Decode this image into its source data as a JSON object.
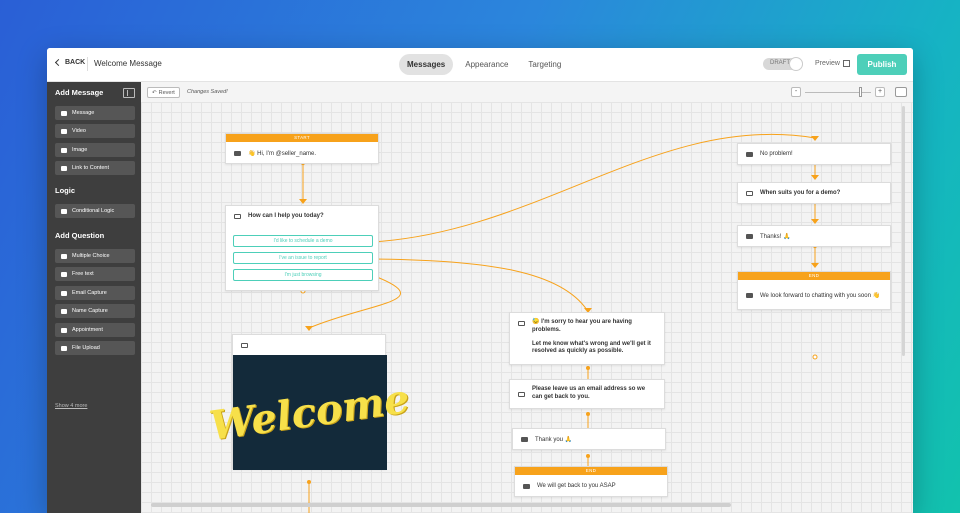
{
  "topbar": {
    "back_label": "BACK",
    "title": "Welcome Message",
    "tabs": [
      "Messages",
      "Appearance",
      "Targeting"
    ],
    "active_tab": "Messages",
    "draft_label": "DRAFT",
    "preview_label": "Preview",
    "publish_label": "Publish"
  },
  "sidebar": {
    "add_message_title": "Add Message",
    "message_items": [
      "Message",
      "Video",
      "Image",
      "Link to Content"
    ],
    "logic_title": "Logic",
    "logic_items": [
      "Conditional Logic"
    ],
    "add_question_title": "Add Question",
    "question_items": [
      "Multiple Choice",
      "Free text",
      "Email Capture",
      "Name Capture",
      "Appointment",
      "File Upload"
    ],
    "show_more": "Show 4 more"
  },
  "canvas_toolbar": {
    "revert_label": "Revert",
    "saved_label": "Changes Saved!",
    "zoom_minus": "-",
    "zoom_plus": "+"
  },
  "nodes": {
    "start_head": "START",
    "start_text": "👋 Hi, I'm @seller_name.",
    "question_text": "How can I help you today?",
    "choices": [
      "I'd like to schedule a demo",
      "I've an issue to report",
      "I'm just browsing"
    ],
    "no_problem": "No problem!",
    "demo_question": "When suits you for a demo?",
    "thanks": "Thanks! 🙏",
    "end_head": "END",
    "end_right_text": "We look forward to chatting with you soon 👋",
    "sorry_line1": "😓 I'm sorry to hear you are having problems.",
    "sorry_line2": "Let me know what's wrong and we'll get it resolved as quickly as possible.",
    "email_text": "Please leave us an email address so we can get back to you.",
    "thank_you": "Thank you 🙏",
    "end_mid_head": "END",
    "end_mid_text": "We will get back to you ASAP",
    "welcome_image_text": "Welcome"
  },
  "colors": {
    "accent": "#f7a21b",
    "teal": "#4dcfb9",
    "sidebar_bg": "#3e3e3e"
  }
}
